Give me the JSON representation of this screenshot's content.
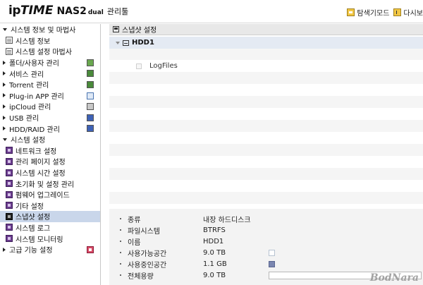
{
  "header": {
    "logo_ip": "ip",
    "logo_time": "TIME",
    "logo_model": "NAS2",
    "logo_dual": "dual",
    "logo_mgr": "관리툴",
    "explorer_mode_label": "탐색기모드",
    "relogin_label": "다시보"
  },
  "sidebar": {
    "items": [
      {
        "label": "시스템 정보 및 마법사"
      },
      {
        "label": "시스템 정보"
      },
      {
        "label": "시스템 설정 마법사"
      },
      {
        "label": "폴더/사용자 관리"
      },
      {
        "label": "서비스 관리"
      },
      {
        "label": "Torrent 관리"
      },
      {
        "label": "Plug-in APP 관리"
      },
      {
        "label": "ipCloud 관리"
      },
      {
        "label": "USB 관리"
      },
      {
        "label": "HDD/RAID 관리"
      },
      {
        "label": "시스템 설정"
      },
      {
        "label": "네트워크 설정"
      },
      {
        "label": "관리 페이지 설정"
      },
      {
        "label": "시스템 시간 설정"
      },
      {
        "label": "초기화 및 설정 관리"
      },
      {
        "label": "펌웨어 업그레이드"
      },
      {
        "label": "기타 설정"
      },
      {
        "label": "스냅샷 설정"
      },
      {
        "label": "시스템 로그"
      },
      {
        "label": "시스템 모니터링"
      },
      {
        "label": "고급 기능 설정"
      }
    ],
    "selected": "스냅샷 설정"
  },
  "main": {
    "title": "스냅샷 설정",
    "tree": {
      "disk": "HDD1",
      "folder": "LogFiles"
    },
    "info": {
      "rows": [
        {
          "label": "종류",
          "value": "내장 하드디스크"
        },
        {
          "label": "파일시스템",
          "value": "BTRFS"
        },
        {
          "label": "이름",
          "value": "HDD1"
        },
        {
          "label": "사용가능공간",
          "value": "9.0 TB"
        },
        {
          "label": "사용중인공간",
          "value": "1.1 GB"
        },
        {
          "label": "전체용량",
          "value": "9.0 TB"
        }
      ],
      "usage_fraction": 0.0001
    }
  },
  "colors": {
    "selected_bg": "#c9d6ea",
    "tree_selected_bg": "#e4eaf3",
    "used_color": "#7a86b0",
    "info_bg": "#f3f3f3"
  },
  "watermark": "BodNara"
}
